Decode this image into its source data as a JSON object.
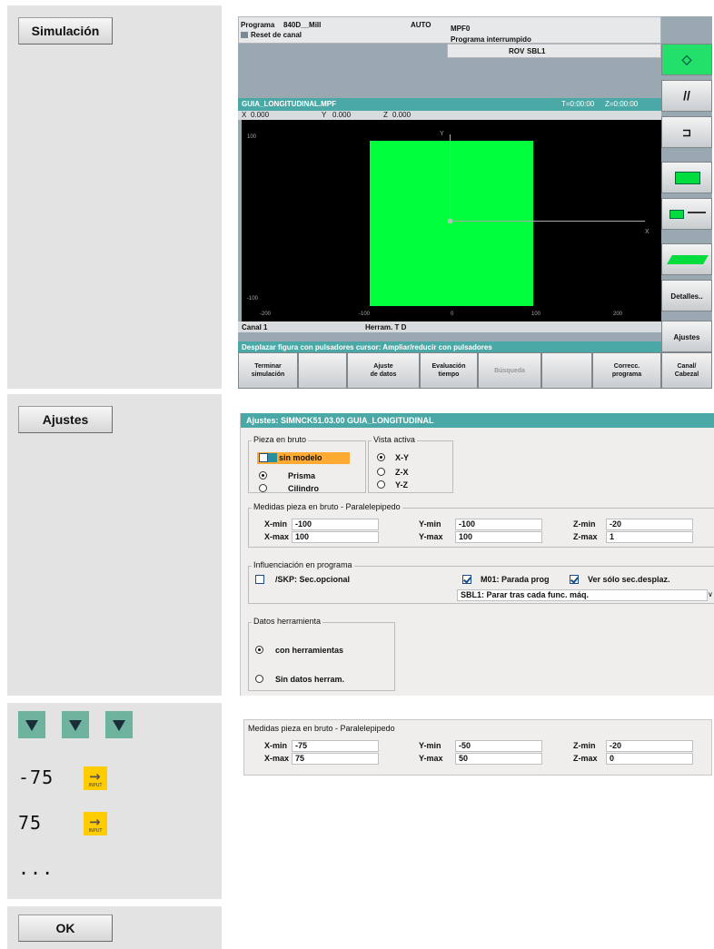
{
  "steps": {
    "simulacion_label": "Simulación",
    "ajustes_label": "Ajustes",
    "value_1": "-75",
    "value_2": "75",
    "ellipsis": "...",
    "ok_label": "OK",
    "input_key_text": "INPUT"
  },
  "sim": {
    "programa_label": "Programa",
    "programa_value": "840D__Mill",
    "mode": "AUTO",
    "program_name": "MPF0",
    "reset": "Reset de canal",
    "status": "Programa interrumpido",
    "rov": "ROV",
    "sbl": "SBL1",
    "file": "GUIA_LONGITUDINAL.MPF",
    "time_1": "T=0:00:00",
    "time_2": "Z=0:00:00",
    "x_label": "X",
    "x_value": "0.000",
    "y_label": "Y",
    "y_value": "0.000",
    "z_label": "Z",
    "z_value": "0.000",
    "axis_y": "Y",
    "axis_x": "X",
    "scale_top": "100",
    "scale_bottom": "-100",
    "ticks": [
      "-200",
      "-100",
      "0",
      "100",
      "200"
    ],
    "canal": "Canal 1",
    "herram": "Herram. T D",
    "hint": "Desplazar figura con pulsadores cursor: Ampliar/reducir con pulsadores",
    "softkeys_v": [
      "",
      "",
      "",
      "",
      "",
      "",
      "Detalles..",
      "Ajustes"
    ],
    "softkeys_h": [
      "Terminar\nsimulación",
      "",
      "Ajuste\nde datos",
      "Evaluación\ntiempo",
      "Búsqueda",
      "",
      "Correcc.\nprograma",
      "Canal/\nCabezal"
    ],
    "colors": {
      "blank": "#00ff3c",
      "accent_bar": "#4aa8a6",
      "start_key": "#22e06a"
    }
  },
  "settings": {
    "title": "Ajustes:  SIMNCK51.03.00   GUIA_LONGITUDINAL",
    "pieza_group": "Pieza en bruto",
    "sin_modelo": "sin modelo",
    "prisma": "Prisma",
    "cilindro": "Cilindro",
    "vista_group": "Vista activa",
    "vista_xy": "X-Y",
    "vista_zx": "Z-X",
    "vista_yz": "Y-Z",
    "medidas_group": "Medidas pieza en bruto - Paralelepipedo",
    "xmin_label": "X-min",
    "xmin": "-100",
    "xmax_label": "X-max",
    "xmax": "100",
    "ymin_label": "Y-min",
    "ymin": "-100",
    "ymax_label": "Y-max",
    "ymax": "100",
    "zmin_label": "Z-min",
    "zmin": "-20",
    "zmax_label": "Z-max",
    "zmax": "1",
    "influ_group": "Influenciación en programa",
    "skp": "/SKP: Sec.opcional",
    "m01": "M01: Parada prog",
    "ver": "Ver sólo sec.desplaz.",
    "sbl_select": "SBL1: Parar tras cada func. máq.",
    "herr_group": "Datos herramienta",
    "con_herr": "con herramientas",
    "sin_herr": "Sin datos herram."
  },
  "excerpt": {
    "group": "Medidas pieza en bruto - Paralelepipedo",
    "xmin_label": "X-min",
    "xmin": "-75",
    "xmax_label": "X-max",
    "xmax": "75",
    "ymin_label": "Y-min",
    "ymin": "-50",
    "ymax_label": "Y-max",
    "ymax": "50",
    "zmin_label": "Z-min",
    "zmin": "-20",
    "zmax_label": "Z-max",
    "zmax": "0"
  }
}
